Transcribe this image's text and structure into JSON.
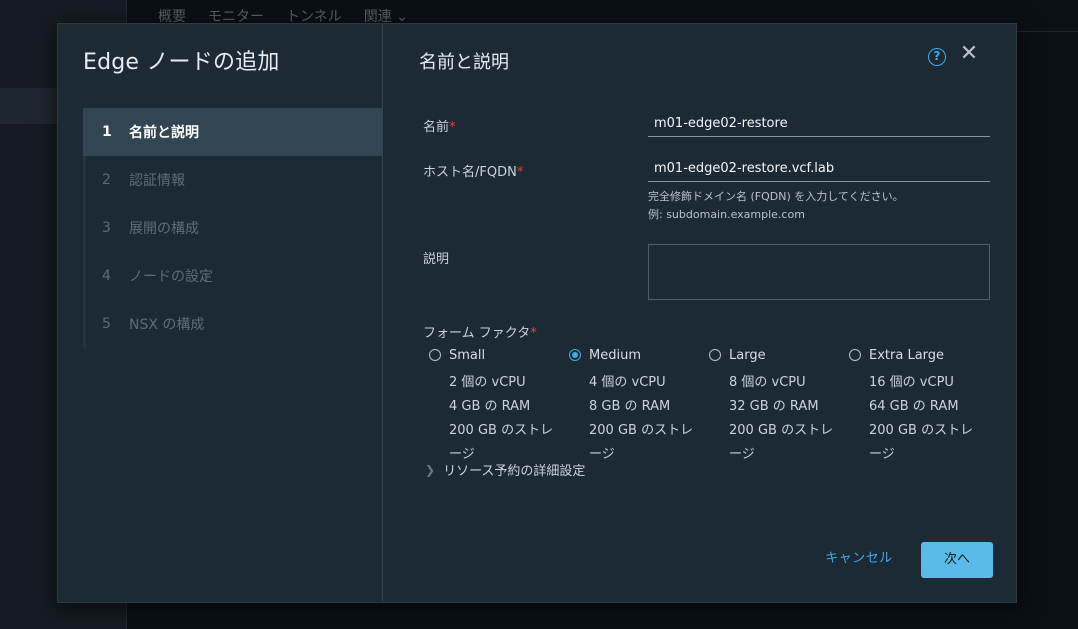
{
  "background": {
    "tabs": [
      "概要",
      "モニター",
      "トンネル",
      "関連 ⌄"
    ]
  },
  "modal": {
    "title": "Edge ノードの追加",
    "steps": [
      {
        "num": "1",
        "label": "名前と説明"
      },
      {
        "num": "2",
        "label": "認証情報"
      },
      {
        "num": "3",
        "label": "展開の構成"
      },
      {
        "num": "4",
        "label": "ノードの設定"
      },
      {
        "num": "5",
        "label": "NSX の構成"
      }
    ],
    "active_step": 1,
    "heading": "名前と説明",
    "help_icon": "?",
    "close_icon": "✕"
  },
  "form": {
    "name_label": "名前",
    "name_value": "m01-edge02-restore",
    "host_label": "ホスト名/FQDN",
    "host_value": "m01-edge02-restore.vcf.lab",
    "host_help_1": "完全修飾ドメイン名 (FQDN) を入力してください。",
    "host_help_2": "例: subdomain.example.com",
    "desc_label": "説明",
    "desc_value": "",
    "required_mark": "*",
    "form_factor_label": "フォーム ファクタ",
    "options": [
      {
        "name": "Small",
        "selected": false,
        "cpu": "2 個の vCPU",
        "ram": "4 GB の RAM",
        "storage_1": "200 GB のストレ",
        "storage_2": "ージ"
      },
      {
        "name": "Medium",
        "selected": true,
        "cpu": "4 個の vCPU",
        "ram": "8 GB の RAM",
        "storage_1": "200 GB のストレ",
        "storage_2": "ージ"
      },
      {
        "name": "Large",
        "selected": false,
        "cpu": "8 個の vCPU",
        "ram": "32 GB の RAM",
        "storage_1": "200 GB のストレ",
        "storage_2": "ージ"
      },
      {
        "name": "Extra Large",
        "selected": false,
        "cpu": "16 個の vCPU",
        "ram": "64 GB の RAM",
        "storage_1": "200 GB のストレ",
        "storage_2": "ージ"
      }
    ],
    "advanced_label": "リソース予約の詳細設定"
  },
  "buttons": {
    "cancel": "キャンセル",
    "next": "次へ"
  },
  "colors": {
    "accent": "#49a8e6",
    "primary_button": "#5bbbe8",
    "required": "#e6413d",
    "modal_bg": "#1b2a35"
  }
}
